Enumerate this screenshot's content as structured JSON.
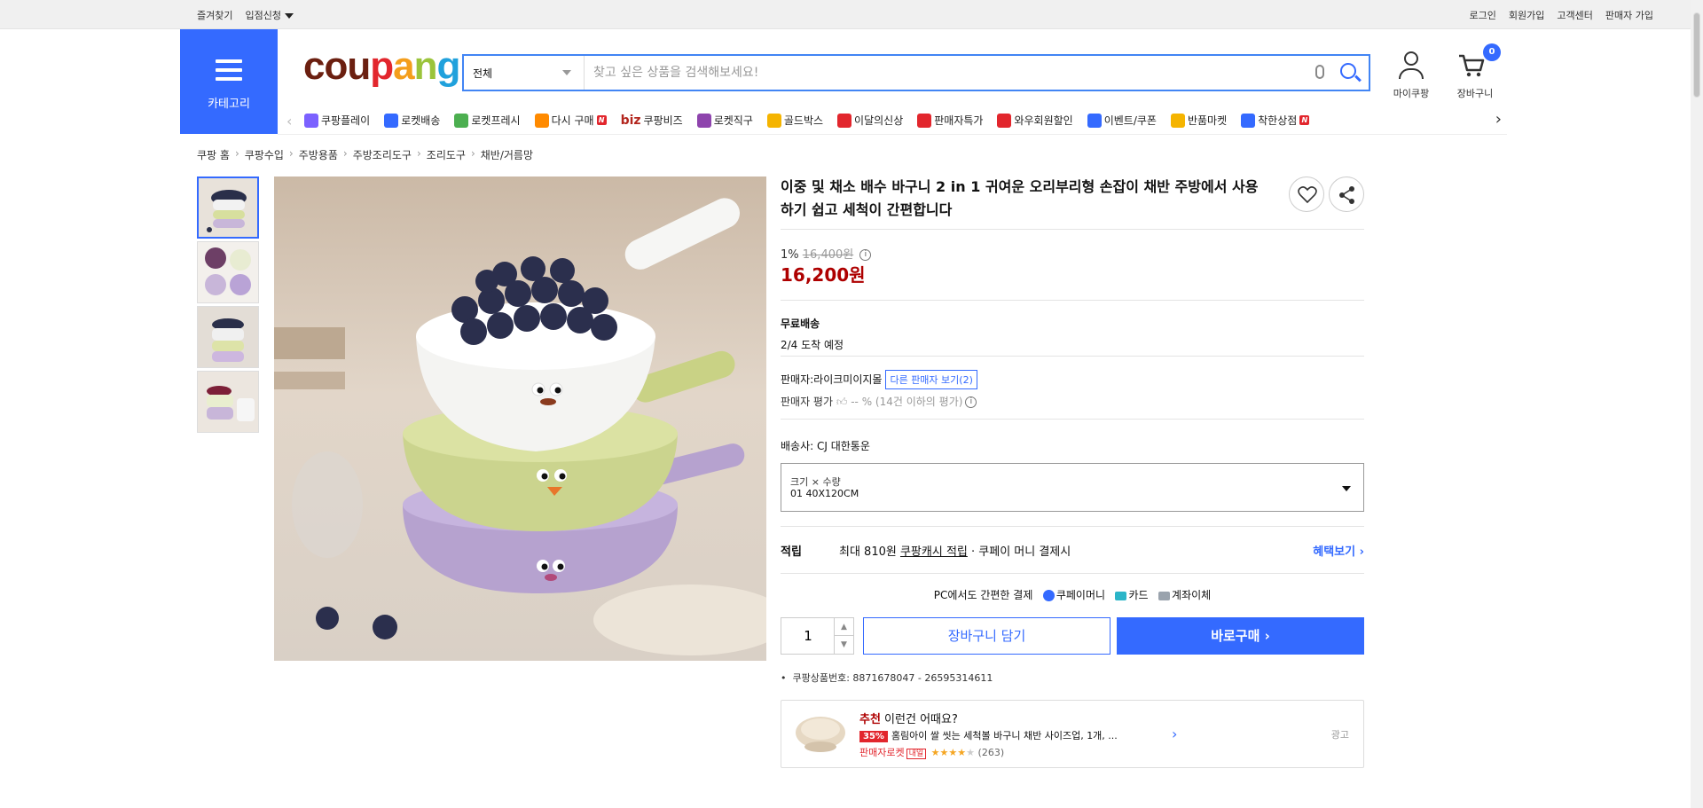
{
  "topbar": {
    "left": [
      "즐겨찾기",
      "입점신청"
    ],
    "right": [
      "로그인",
      "회원가입",
      "고객센터",
      "판매자 가입"
    ]
  },
  "header": {
    "category_label": "카테고리",
    "logo": [
      "cou",
      "p",
      "a",
      "n",
      "g"
    ],
    "search_scope": "전체",
    "search_placeholder": "찾고 싶은 상품을 검색해보세요!",
    "my_label": "마이쿠팡",
    "cart_label": "장바구니",
    "cart_count": "0"
  },
  "nav": [
    {
      "label": "쿠팡플레이",
      "icon": "play-icon",
      "color": "#7b61ff"
    },
    {
      "label": "로켓배송",
      "icon": "rocket-icon",
      "color": "#346aff"
    },
    {
      "label": "로켓프레시",
      "icon": "rocket-fresh-icon",
      "color": "#4caf50"
    },
    {
      "label": "다시 구매",
      "icon": "rebuy-icon",
      "color": "#ff8a00",
      "badge": "N"
    },
    {
      "label": "쿠팡비즈",
      "icon": "biz-icon",
      "color": "#b3261e",
      "prefix": "biz"
    },
    {
      "label": "로켓직구",
      "icon": "global-icon",
      "color": "#8e44ad"
    },
    {
      "label": "골드박스",
      "icon": "goldbox-icon",
      "color": "#f5b400"
    },
    {
      "label": "이달의신상",
      "icon": "new-icon",
      "color": "#e2262d"
    },
    {
      "label": "판매자특가",
      "icon": "percent-icon",
      "color": "#e2262d"
    },
    {
      "label": "와우회원할인",
      "icon": "wow-icon",
      "color": "#e2262d"
    },
    {
      "label": "이벤트/쿠폰",
      "icon": "coupon-icon",
      "color": "#346aff"
    },
    {
      "label": "반품마켓",
      "icon": "return-icon",
      "color": "#f5b400"
    },
    {
      "label": "착한상점",
      "icon": "store-icon",
      "color": "#346aff",
      "badge": "N"
    }
  ],
  "breadcrumb": [
    "쿠팡 홈",
    "쿠팡수입",
    "주방용품",
    "주방조리도구",
    "조리도구",
    "채반/거름망"
  ],
  "product": {
    "title": "이중 및 채소 배수 바구니 2 in 1 귀여운 오리부리형 손잡이 채반 주방에서 사용하기 쉽고 세척이 간편합니다",
    "discount": "1%",
    "original_price": "16,400원",
    "price": "16,200원",
    "shipping_title": "무료배송",
    "shipping_eta": "2/4 도착 예정",
    "seller": "판매자:라이크미이지몰",
    "other_sellers": "다른 판매자 보기(2)",
    "seller_rating": "판매자 평가",
    "seller_rating_value": "-- % (14건 이하의 평가)",
    "courier": "배송사:  CJ 대한통운",
    "option_label": "크기 × 수량",
    "option_value": "01 40X120CM",
    "reward_key": "적립",
    "reward_text_1": "최대 810원 ",
    "reward_link": "쿠팡캐시 적립",
    "reward_text_2": " · 쿠페이 머니 결제시",
    "reward_more": "혜택보기 ›",
    "pay_title": "PC에서도 간편한 결제",
    "pay_methods": [
      "쿠페이머니",
      "카드",
      "계좌이체"
    ],
    "quantity": "1",
    "add_cart": "장바구니 담기",
    "buy_now": "바로구매 ›",
    "product_no": "쿠팡상품번호: 8871678047 - 26595314611"
  },
  "recommend": {
    "prefix": "추천",
    "heading": " 이런건 어때요?",
    "discount": "35%",
    "name": "홈림아이 쌀 씻는 세척볼 바구니 채반 사이즈업, 1개, ...",
    "badge": "판매자로켓",
    "badge2": "내일",
    "rating": 4,
    "reviews": "(263)",
    "ad": "광고"
  },
  "colors": {
    "accent": "#346aff",
    "price": "#ae0000"
  }
}
